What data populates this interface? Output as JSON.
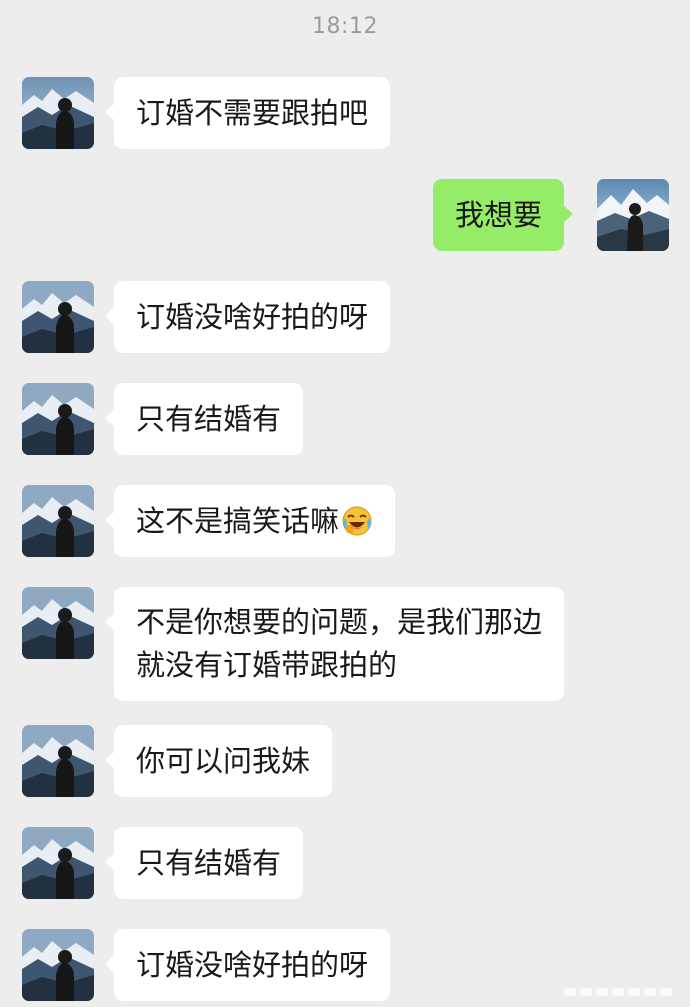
{
  "timestamp": "18:12",
  "messages": [
    {
      "side": "left",
      "text": "订婚不需要跟拍吧"
    },
    {
      "side": "right",
      "text": "我想要"
    },
    {
      "side": "left",
      "text": "订婚没啥好拍的呀"
    },
    {
      "side": "left",
      "text": "只有结婚有"
    },
    {
      "side": "left",
      "text": "这不是搞笑话嘛",
      "emoji": "laughing-crying-emoji"
    },
    {
      "side": "left",
      "lines": [
        "不是你想要的问题，是我们那边",
        "就没有订婚带跟拍的"
      ]
    },
    {
      "side": "left",
      "text": "你可以问我妹"
    },
    {
      "side": "left",
      "text": "只有结婚有"
    },
    {
      "side": "left",
      "text": "订婚没啥好拍的呀"
    }
  ],
  "colors": {
    "background": "#ededed",
    "incoming_bubble": "#ffffff",
    "outgoing_bubble": "#95ec69",
    "text": "#191919",
    "timestamp": "#9a9a9a"
  }
}
